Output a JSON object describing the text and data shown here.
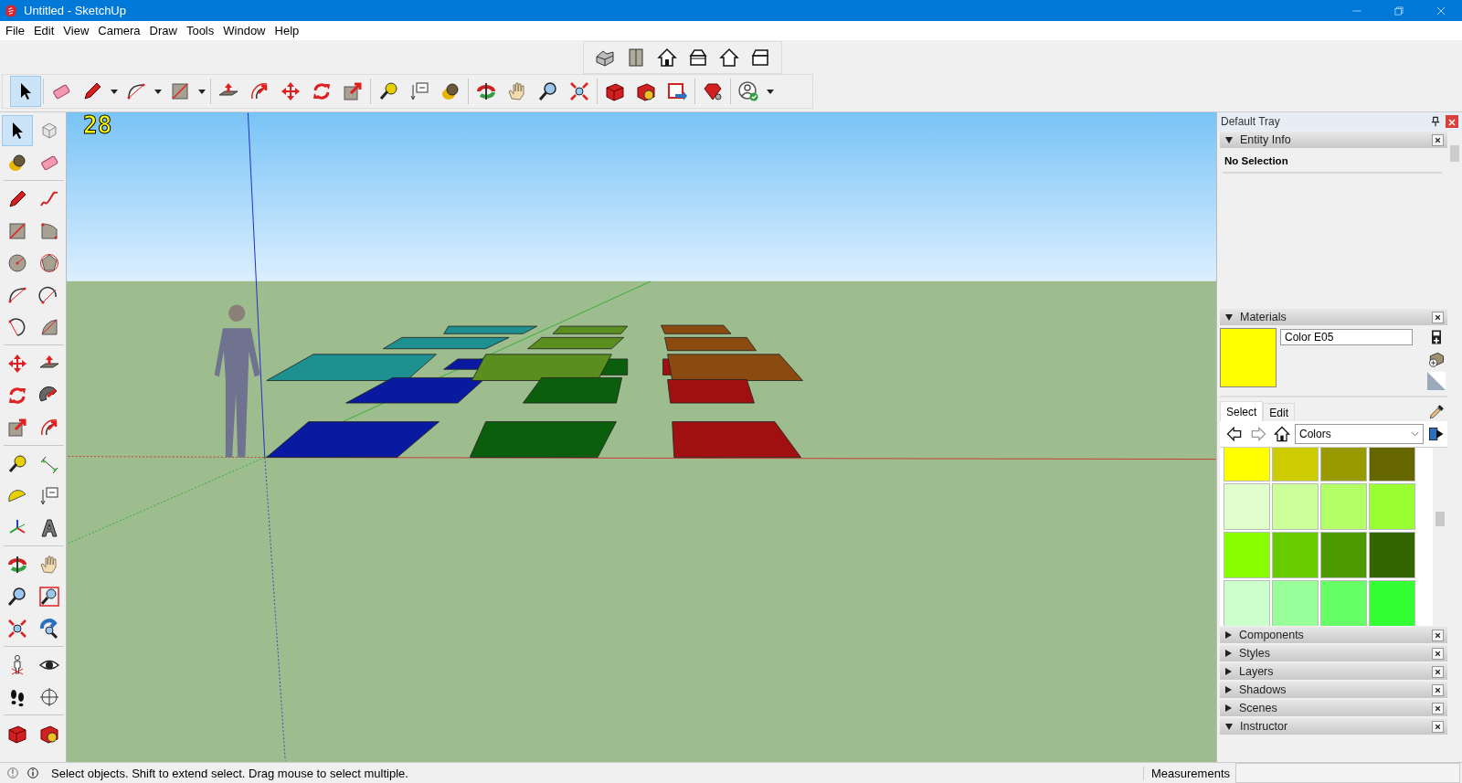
{
  "window": {
    "title": "Untitled - SketchUp"
  },
  "menu": [
    "File",
    "Edit",
    "View",
    "Camera",
    "Draw",
    "Tools",
    "Window",
    "Help"
  ],
  "select_tool": {
    "selected": true
  },
  "viewport": {
    "label": "28"
  },
  "tray": {
    "title": "Default Tray",
    "entity_info": {
      "title": "Entity Info",
      "expanded": true,
      "text": "No Selection"
    },
    "materials": {
      "title": "Materials",
      "expanded": true,
      "name": "Color E05",
      "color": "#ffff00",
      "tabs": [
        {
          "label": "Select",
          "selected": true
        },
        {
          "label": "Edit",
          "selected": false
        }
      ],
      "library": "Colors",
      "swatches": [
        {
          "color": "#ffff00"
        },
        {
          "color": "#cccc00"
        },
        {
          "color": "#999900"
        },
        {
          "color": "#666600"
        },
        {
          "color": "#e0ffcc"
        },
        {
          "color": "#ccff99"
        },
        {
          "color": "#b3ff66"
        },
        {
          "color": "#99ff33"
        },
        {
          "color": "#88ff00"
        },
        {
          "color": "#66cc00"
        },
        {
          "color": "#4d9900"
        },
        {
          "color": "#336600"
        },
        {
          "color": "#ccffcc"
        },
        {
          "color": "#99ff99"
        },
        {
          "color": "#66ff66"
        },
        {
          "color": "#33ff33"
        }
      ]
    },
    "panels": [
      {
        "title": "Components",
        "expanded": false
      },
      {
        "title": "Styles",
        "expanded": false
      },
      {
        "title": "Layers",
        "expanded": false
      },
      {
        "title": "Shadows",
        "expanded": false
      },
      {
        "title": "Scenes",
        "expanded": false
      },
      {
        "title": "Instructor",
        "expanded": true
      }
    ]
  },
  "status_bar": {
    "message": "Select objects. Shift to extend select. Drag mouse to select multiple.",
    "measurements_label": "Measurements"
  }
}
